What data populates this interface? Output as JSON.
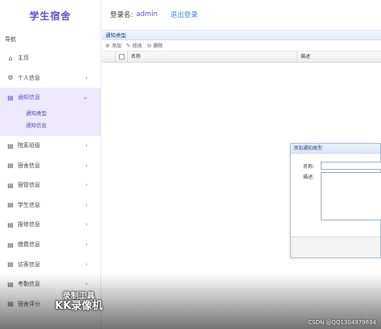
{
  "app_title": "学生宿舍",
  "nav_heading": "导航",
  "sidebar": {
    "items": [
      {
        "label": "主页",
        "icon": "home-icon"
      },
      {
        "label": "个人信息",
        "icon": "gear-icon"
      },
      {
        "label": "通知信息",
        "icon": "doc-icon",
        "children": [
          "通知类型",
          "通知信息"
        ]
      },
      {
        "label": "院系班级",
        "icon": "doc-icon"
      },
      {
        "label": "宿舍信息",
        "icon": "doc-icon"
      },
      {
        "label": "宿管信息",
        "icon": "doc-icon"
      },
      {
        "label": "学生信息",
        "icon": "doc-icon"
      },
      {
        "label": "报修信息",
        "icon": "doc-icon"
      },
      {
        "label": "缴费信息",
        "icon": "doc-icon"
      },
      {
        "label": "访客信息",
        "icon": "doc-icon"
      },
      {
        "label": "考勤信息",
        "icon": "doc-icon"
      },
      {
        "label": "宿舍评分",
        "icon": "doc-icon"
      }
    ]
  },
  "header": {
    "login_label": "登录名:",
    "username": "admin",
    "logout": "退出登录"
  },
  "panel": {
    "title": "通知类型",
    "toolbar": {
      "add": "添加",
      "edit": "修改",
      "delete": "删除"
    },
    "columns": [
      "名称",
      "描述"
    ]
  },
  "dialog": {
    "title": "添加通知类型",
    "name_label": "名称:",
    "desc_label": "描述:"
  },
  "overlay": {
    "watermark_line1": "录制工具",
    "watermark_line2": "KK录像机",
    "csdn": "CSDN @QQ1304979694"
  },
  "colors": {
    "accent": "#5b4fd3",
    "active_bg": "#ede9fb",
    "link": "#4a7fd8"
  }
}
